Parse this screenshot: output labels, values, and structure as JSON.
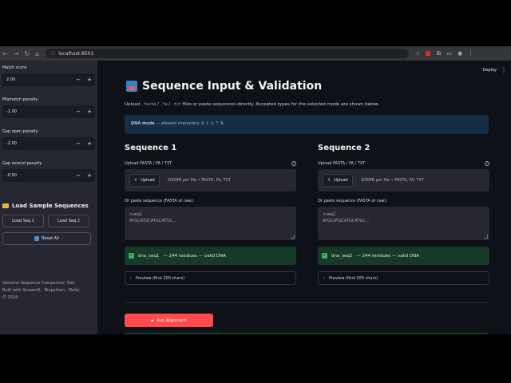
{
  "browser": {
    "url": "localhost:8501",
    "nav_back": "←",
    "nav_forward": "→",
    "nav_reload": "↻",
    "nav_home": "⌂",
    "ext_star": "☆",
    "ext_puzzle": "⊞",
    "ext_profile": "◉",
    "ext_menu": "⋮"
  },
  "sidebar": {
    "match_score": {
      "label": "Match score",
      "value": "2.00"
    },
    "mismatch_penalty": {
      "label": "Mismatch penalty",
      "value": "-1.00"
    },
    "gap_open_penalty": {
      "label": "Gap open penalty",
      "value": "-2.00"
    },
    "gap_extend_penalty": {
      "label": "Gap extend penalty",
      "value": "-0.50"
    },
    "minus": "−",
    "plus": "+",
    "load_samples_title": "Load Sample Sequences",
    "load_seq1": "Load Seq 1",
    "load_seq2": "Load Seq 2",
    "reset_all": "Reset All",
    "footer_line1": "Genome Sequence Comparison Tool",
    "footer_line2": "Built with Streamlit · Biopython · Plotly",
    "footer_line3": "© 2024"
  },
  "header": {
    "deploy": "Deploy",
    "menu": "⋮"
  },
  "main": {
    "title": "Sequence Input & Validation",
    "subtitle_pre": "Upload",
    "ext1": ".fasta",
    "sep": "/",
    "ext2": ".fa",
    "ext3": ".txt",
    "subtitle_post": "files or paste sequences directly. Accepted types for the selected mode are shown below.",
    "info_mode": "DNA mode",
    "info_text": "— allowed characters:",
    "info_chars": "A C G T N",
    "upload_button": "Upload",
    "upload_note": "200MB per file • FASTA, FA, TXT",
    "upload_label": "Upload FASTA / FA / TXT",
    "paste_label": "Or paste sequence (FASTA or raw):",
    "preview_label": "Preview (first 200 chars)",
    "run_label": "Run Alignment"
  },
  "seq1": {
    "heading": "Sequence 1",
    "placeholder_line1": ">seq1",
    "placeholder_line2": "ATGCATGCATGCATGC...",
    "status_name": "dna_seq1",
    "status_text": "— 244 residues — valid DNA"
  },
  "seq2": {
    "heading": "Sequence 2",
    "placeholder_line1": ">seq2",
    "placeholder_line2": "ATGCATGCATGCATGC...",
    "status_name": "dna_seq2",
    "status_text": "— 244 residues — valid DNA"
  },
  "colors": {
    "accent": "#ff4b4b",
    "success_bg": "#173928",
    "info_bg": "#172d43",
    "sidebar_bg": "#262730",
    "page_bg": "#0e1117"
  }
}
